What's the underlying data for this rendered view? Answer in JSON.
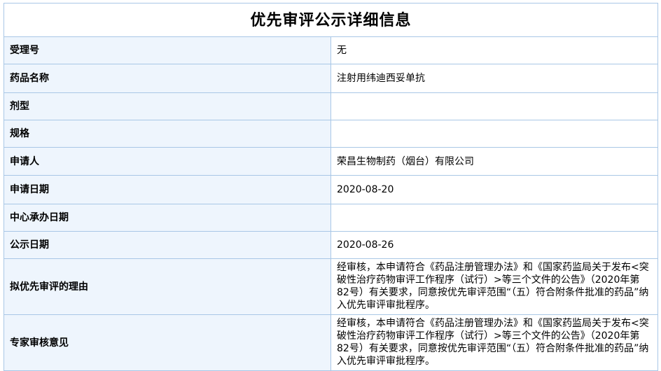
{
  "title": "优先审评公示详细信息",
  "rows": [
    {
      "label": "受理号",
      "value": "无"
    },
    {
      "label": "药品名称",
      "value": "注射用纬迪西妥单抗"
    },
    {
      "label": "剂型",
      "value": ""
    },
    {
      "label": "规格",
      "value": ""
    },
    {
      "label": "申请人",
      "value": "荣昌生物制药（烟台）有限公司"
    },
    {
      "label": "申请日期",
      "value": "2020-08-20"
    },
    {
      "label": "中心承办日期",
      "value": ""
    },
    {
      "label": "公示日期",
      "value": "2020-08-26"
    },
    {
      "label": "拟优先审评的理由",
      "value": "经审核，本申请符合《药品注册管理办法》和《国家药监局关于发布<突破性治疗药物审评工作程序（试行）>等三个文件的公告》（2020年第82号）有关要求，同意按优先审评范围“（五）符合附条件批准的药品”纳入优先审评审批程序。"
    },
    {
      "label": "专家审核意见",
      "value": "经审核，本申请符合《药品注册管理办法》和《国家药监局关于发布<突破性治疗药物审评工作程序（试行）>等三个文件的公告》（2020年第82号）有关要求，同意按优先审评范围“（五）符合附条件批准的药品”纳入优先审评审批程序。"
    }
  ]
}
